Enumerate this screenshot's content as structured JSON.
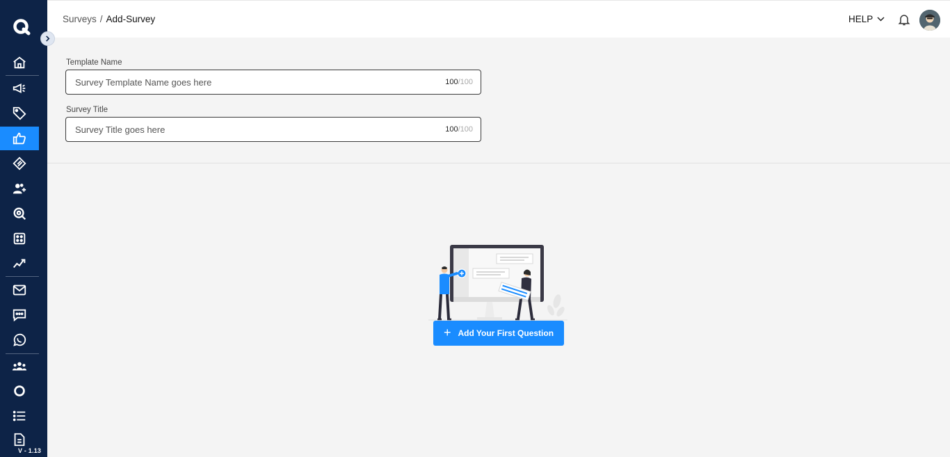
{
  "breadcrumb": {
    "parent": "Surveys",
    "separator": "/",
    "current": "Add-Survey"
  },
  "header": {
    "help_label": "HELP"
  },
  "form": {
    "template_name": {
      "label": "Template Name",
      "placeholder": "Survey Template Name goes here",
      "count": "100",
      "max": "/100"
    },
    "survey_title": {
      "label": "Survey Title",
      "placeholder": "Survey Title goes here",
      "count": "100",
      "max": "/100"
    }
  },
  "empty_state": {
    "button_label": "Add Your First Question",
    "button_icon": "plus-icon"
  },
  "sidebar": {
    "version": "V - 1.13",
    "active_item": "surveys",
    "items": [
      "home-icon",
      "campaign-icon",
      "tag-icon",
      "surveys-icon",
      "offers-icon",
      "add-contacts-icon",
      "search-icon",
      "dice-icon",
      "analytics-icon",
      "mail-icon",
      "sms-icon",
      "whatsapp-icon",
      "audience-icon",
      "segments-icon",
      "list-icon",
      "document-icon"
    ]
  },
  "colors": {
    "sidebar": "#0d2347",
    "accent": "#1a8cff",
    "background": "#f4f4f4"
  }
}
